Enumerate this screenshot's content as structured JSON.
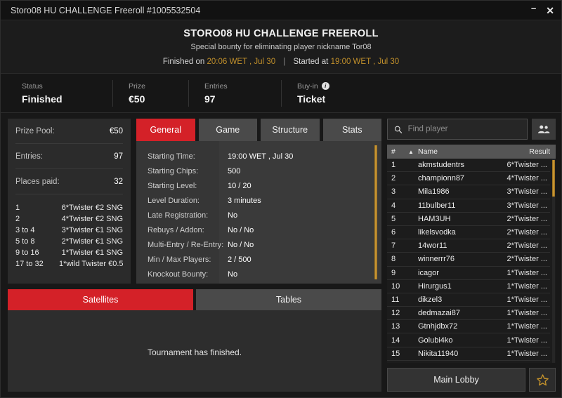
{
  "titlebar": {
    "text": "Storo08 HU CHALLENGE Freeroll #1005532504",
    "minimize": "–",
    "close": "✕"
  },
  "header": {
    "title": "STORO08 HU CHALLENGE FREEROLL",
    "subtitle": "Special bounty for eliminating player nickname Tor08",
    "finished_label": "Finished on",
    "finished_time": "20:06 WET , Jul 30",
    "divider": "|",
    "started_label": "Started at",
    "started_time": "19:00 WET , Jul 30"
  },
  "status": [
    {
      "label": "Status",
      "value": "Finished",
      "info": false
    },
    {
      "label": "Prize",
      "value": "€50",
      "info": false
    },
    {
      "label": "Entries",
      "value": "97",
      "info": false
    },
    {
      "label": "Buy-in",
      "value": "Ticket",
      "info": true,
      "info_glyph": "i"
    }
  ],
  "prize_panel": {
    "rows": [
      {
        "key": "Prize Pool:",
        "value": "€50"
      },
      {
        "key": "Entries:",
        "value": "97"
      },
      {
        "key": "Places paid:",
        "value": "32"
      }
    ],
    "payouts": [
      {
        "place": "1",
        "prize": "6*Twister €2 SNG"
      },
      {
        "place": "2",
        "prize": "4*Twister €2 SNG"
      },
      {
        "place": "3  to  4",
        "prize": "3*Twister €1 SNG"
      },
      {
        "place": "5  to  8",
        "prize": "2*Twister €1 SNG"
      },
      {
        "place": "9  to  16",
        "prize": "1*Twister €1 SNG"
      },
      {
        "place": "17  to  32",
        "prize": "1*wild Twister €0.5"
      }
    ]
  },
  "tabs": [
    {
      "label": "General",
      "active": true
    },
    {
      "label": "Game",
      "active": false
    },
    {
      "label": "Structure",
      "active": false
    },
    {
      "label": "Stats",
      "active": false
    }
  ],
  "general": [
    {
      "key": "Starting Time:",
      "value": "19:00 WET , Jul 30"
    },
    {
      "key": "Starting Chips:",
      "value": "500"
    },
    {
      "key": "Starting Level:",
      "value": "10 / 20"
    },
    {
      "key": "Level Duration:",
      "value": "3 minutes"
    },
    {
      "key": "Late Registration:",
      "value": "No"
    },
    {
      "key": "Rebuys / Addon:",
      "value": "No / No"
    },
    {
      "key": "Multi-Entry / Re-Entry:",
      "value": "No / No"
    },
    {
      "key": "Min / Max Players:",
      "value": "2 / 500"
    },
    {
      "key": "Knockout Bounty:",
      "value": "No"
    }
  ],
  "subtabs": [
    {
      "label": "Satellites",
      "active": true
    },
    {
      "label": "Tables",
      "active": false
    }
  ],
  "subcontent": {
    "message": "Tournament has finished."
  },
  "search": {
    "placeholder": "Find player",
    "value": ""
  },
  "player_list": {
    "columns": {
      "num": "#",
      "sort": "▲",
      "name": "Name",
      "result": "Result"
    },
    "rows": [
      {
        "num": "1",
        "name": "akmstudentrs",
        "result": "6*Twister ..."
      },
      {
        "num": "2",
        "name": "championn87",
        "result": "4*Twister ..."
      },
      {
        "num": "3",
        "name": "Mila1986",
        "result": "3*Twister ..."
      },
      {
        "num": "4",
        "name": "11bulber11",
        "result": "3*Twister ..."
      },
      {
        "num": "5",
        "name": "HAM3UH",
        "result": "2*Twister ..."
      },
      {
        "num": "6",
        "name": "likelsvodka",
        "result": "2*Twister ..."
      },
      {
        "num": "7",
        "name": "14wor11",
        "result": "2*Twister ..."
      },
      {
        "num": "8",
        "name": "winnerrr76",
        "result": "2*Twister ..."
      },
      {
        "num": "9",
        "name": "icagor",
        "result": "1*Twister ..."
      },
      {
        "num": "10",
        "name": "Hirurgus1",
        "result": "1*Twister ..."
      },
      {
        "num": "11",
        "name": "dikzel3",
        "result": "1*Twister ..."
      },
      {
        "num": "12",
        "name": "dedmazai87",
        "result": "1*Twister ..."
      },
      {
        "num": "13",
        "name": "Gtnhjdbx72",
        "result": "1*Twister ..."
      },
      {
        "num": "14",
        "name": "Golubi4ko",
        "result": "1*Twister ..."
      },
      {
        "num": "15",
        "name": "Nikita11940",
        "result": "1*Twister ..."
      }
    ]
  },
  "footer": {
    "main_lobby": "Main Lobby",
    "favourite_icon": "star-icon"
  },
  "colors": {
    "accent_red": "#d42128",
    "gold": "#c08f2b",
    "panel": "#2b2b2b",
    "background": "#181818"
  }
}
